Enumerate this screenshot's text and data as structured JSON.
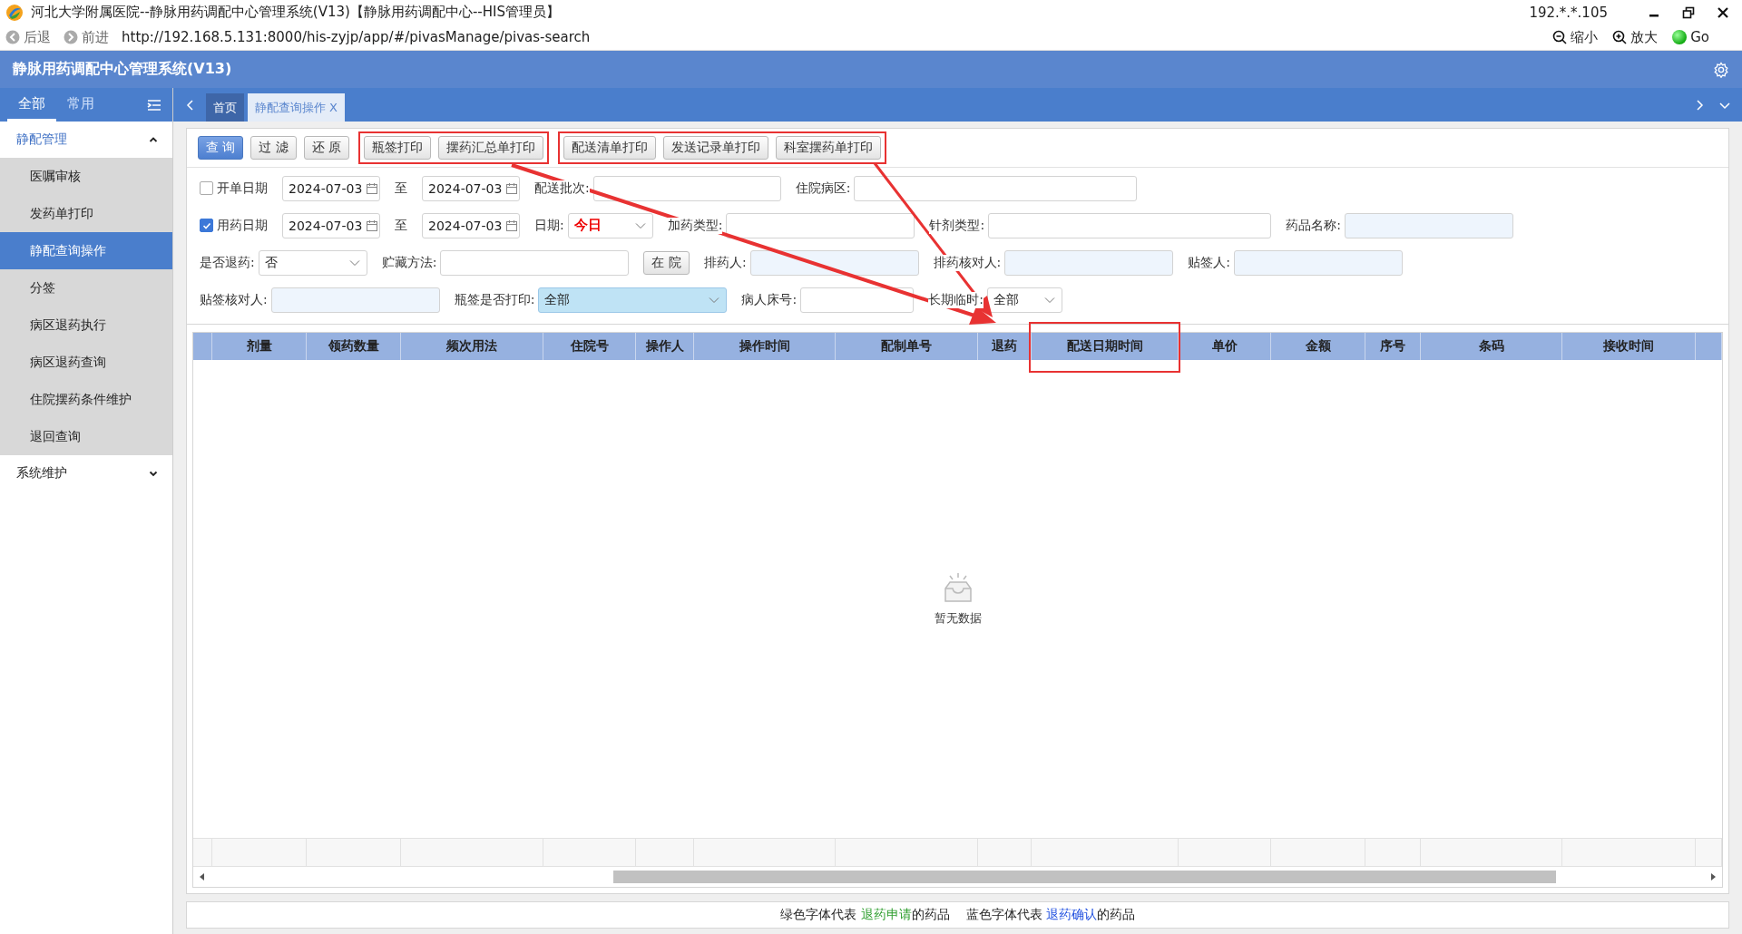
{
  "window": {
    "title": "河北大学附属医院--静脉用药调配中心管理系统(V13)【静脉用药调配中心--HIS管理员】",
    "ip": "192.*.*.105"
  },
  "address_bar": {
    "back": "后退",
    "forward": "前进",
    "url": "http://192.168.5.131:8000/his-zyjp/app/#/pivasManage/pivas-search",
    "zoom_out": "缩小",
    "zoom_in": "放大",
    "go": "Go"
  },
  "app": {
    "title": "静脉用药调配中心管理系统(V13)"
  },
  "sidebar": {
    "tabs": [
      {
        "label": "全部",
        "selected": true
      },
      {
        "label": "常用",
        "selected": false
      }
    ],
    "groups": [
      {
        "label": "静配管理",
        "expanded": true,
        "children": [
          {
            "label": "医嘱审核",
            "selected": false
          },
          {
            "label": "发药单打印",
            "selected": false
          },
          {
            "label": "静配查询操作",
            "selected": true
          },
          {
            "label": "分签",
            "selected": false
          },
          {
            "label": "病区退药执行",
            "selected": false
          },
          {
            "label": "病区退药查询",
            "selected": false
          },
          {
            "label": "住院摆药条件维护",
            "selected": false
          },
          {
            "label": "退回查询",
            "selected": false
          }
        ]
      },
      {
        "label": "系统维护",
        "expanded": false
      }
    ]
  },
  "tabs": [
    {
      "label": "首页",
      "selected": false
    },
    {
      "label": "静配查询操作",
      "selected": true,
      "close": "X"
    }
  ],
  "toolbar": [
    {
      "annotated": false,
      "buttons": [
        {
          "label": "查 询",
          "kind": "primary"
        },
        {
          "label": "过 滤",
          "kind": "default"
        },
        {
          "label": "还 原",
          "kind": "default"
        }
      ]
    },
    {
      "annotated": true,
      "buttons": [
        {
          "label": "瓶签打印",
          "kind": "default"
        },
        {
          "label": "摆药汇总单打印",
          "kind": "default"
        }
      ]
    },
    {
      "annotated": true,
      "buttons": [
        {
          "label": "配送清单打印",
          "kind": "default"
        },
        {
          "label": "发送记录单打印",
          "kind": "default"
        },
        {
          "label": "科室摆药单打印",
          "kind": "default"
        }
      ]
    }
  ],
  "filters": [
    [
      {
        "kind": "check",
        "label": "开单日期",
        "checked": false
      },
      {
        "kind": "date",
        "value": "2024-07-03"
      },
      {
        "kind": "label",
        "text": "至"
      },
      {
        "kind": "date",
        "value": "2024-07-03"
      },
      {
        "kind": "text",
        "label": "配送批次:"
      },
      {
        "kind": "text",
        "label": "住院病区:"
      }
    ],
    [
      {
        "kind": "check",
        "label": "用药日期",
        "checked": true
      },
      {
        "kind": "date",
        "value": "2024-07-03"
      },
      {
        "kind": "label",
        "text": "至"
      },
      {
        "kind": "date",
        "value": "2024-07-03"
      },
      {
        "kind": "select",
        "label": "日期:",
        "value": "今日",
        "emphasis": true,
        "highlighted": false
      },
      {
        "kind": "text",
        "label": "加药类型:"
      },
      {
        "kind": "text",
        "label": "针剂类型:"
      },
      {
        "kind": "lookup",
        "label": "药品名称:"
      }
    ],
    [
      {
        "kind": "select",
        "label": "是否退药:",
        "value": "否",
        "emphasis": false,
        "highlighted": false
      },
      {
        "kind": "text",
        "label": "贮藏方法:"
      },
      {
        "kind": "button",
        "label": "在 院"
      },
      {
        "kind": "lookup",
        "label": "排药人:"
      },
      {
        "kind": "lookup",
        "label": "排药核对人:"
      },
      {
        "kind": "lookup",
        "label": "贴签人:"
      }
    ],
    [
      {
        "kind": "lookup",
        "label": "贴签核对人:"
      },
      {
        "kind": "select",
        "label": "瓶签是否打印:",
        "value": "全部",
        "emphasis": false,
        "highlighted": true
      },
      {
        "kind": "text",
        "label": "病人床号:"
      },
      {
        "kind": "select",
        "label": "长期临时:",
        "value": "全部",
        "emphasis": false,
        "highlighted": false
      }
    ]
  ],
  "table": {
    "columns": [
      {
        "label": "剂量",
        "annotated": false
      },
      {
        "label": "领药数量",
        "annotated": false
      },
      {
        "label": "频次用法",
        "annotated": false
      },
      {
        "label": "住院号",
        "annotated": false
      },
      {
        "label": "操作人",
        "annotated": false
      },
      {
        "label": "操作时间",
        "annotated": false
      },
      {
        "label": "配制单号",
        "annotated": false
      },
      {
        "label": "退药",
        "annotated": false
      },
      {
        "label": "配送日期时间",
        "annotated": true
      },
      {
        "label": "单价",
        "annotated": false
      },
      {
        "label": "金额",
        "annotated": false
      },
      {
        "label": "序号",
        "annotated": false
      },
      {
        "label": "条码",
        "annotated": false
      },
      {
        "label": "接收时间",
        "annotated": false
      }
    ],
    "empty_text": "暂无数据"
  },
  "legend": [
    {
      "text": "绿色字体代表 ",
      "term": "退药申请",
      "suffix": "的药品",
      "color": "#2e9e2e"
    },
    {
      "text": "蓝色字体代表 ",
      "term": "退药确认",
      "suffix": "的药品",
      "color": "#1f4fe0"
    }
  ]
}
